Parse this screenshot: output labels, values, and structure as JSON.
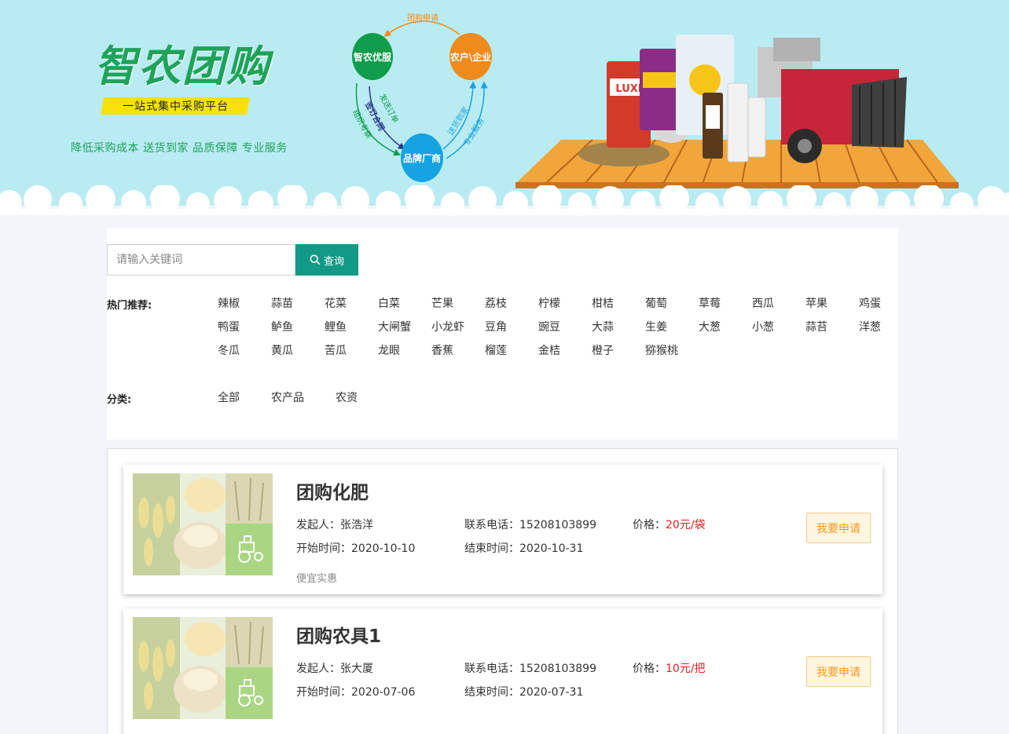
{
  "banner": {
    "logo_title": "智农团购",
    "logo_slogan": "一站式集中采购平台",
    "logo_features": "降低采购成本  送货到家  品质保障  专业服务",
    "cycle": {
      "node_a": "智农优服",
      "node_b": "农户\\企业",
      "node_c": "品牌厂商",
      "top_label": "团购申请",
      "left_outer": "组织考察",
      "left_mid": "签订合同",
      "left_inner": "发送订单",
      "right_inner": "送货到家",
      "right_outer": "专业服务"
    },
    "product_bag_label": "LUXI",
    "colors": {
      "sky": "#b9ecf2",
      "brand_green": "#1fa35a",
      "orange": "#ef8a1c",
      "blue": "#17a3e1"
    }
  },
  "search": {
    "placeholder": "请输入关键词",
    "button_label": "查询"
  },
  "hot": {
    "label": "热门推荐:",
    "tags": [
      "辣椒",
      "蒜苗",
      "花菜",
      "白菜",
      "芒果",
      "荔枝",
      "柠檬",
      "柑桔",
      "葡萄",
      "草莓",
      "西瓜",
      "苹果",
      "鸡蛋",
      "鸭蛋",
      "鲈鱼",
      "鲤鱼",
      "大闸蟹",
      "小龙虾",
      "豆角",
      "豌豆",
      "大蒜",
      "生姜",
      "大葱",
      "小葱",
      "蒜苔",
      "洋葱",
      "冬瓜",
      "黄瓜",
      "苦瓜",
      "龙眼",
      "香蕉",
      "榴莲",
      "金桔",
      "橙子",
      "猕猴桃"
    ]
  },
  "category": {
    "label": "分类:",
    "options": [
      "全部",
      "农产品",
      "农资"
    ]
  },
  "listings": [
    {
      "title": "团购化肥",
      "initiator": "发起人：张浩洋",
      "phone": "联系电话：15208103899",
      "price_label": "价格：",
      "price": "20元/袋",
      "start": "开始时间：2020-10-10",
      "end": "结束时间：2020-10-31",
      "desc": "便宜实惠",
      "apply_label": "我要申请"
    },
    {
      "title": "团购农具1",
      "initiator": "发起人：张大厦",
      "phone": "联系电话：15208103899",
      "price_label": "价格：",
      "price": "10元/把",
      "start": "开始时间：2020-07-06",
      "end": "结束时间：2020-07-31",
      "desc": "",
      "apply_label": "我要申请"
    }
  ]
}
